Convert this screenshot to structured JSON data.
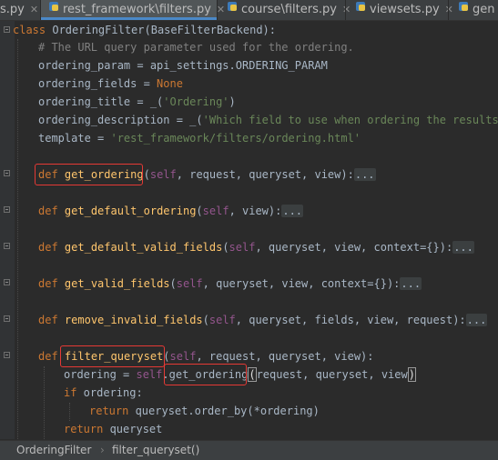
{
  "tabs": [
    {
      "label": "s.py",
      "active": false
    },
    {
      "label": "rest_framework\\filters.py",
      "active": true
    },
    {
      "label": "course\\filters.py",
      "active": false
    },
    {
      "label": "viewsets.py",
      "active": false
    },
    {
      "label": "gen",
      "active": false
    }
  ],
  "code": {
    "class_line": {
      "kw": "class",
      "rest": " OrderingFilter(BaseFilterBackend):"
    },
    "comment": "# The URL query parameter used for the ordering.",
    "ordering_param": {
      "lhs": "ordering_param = api_settings.ORDERING_PARAM"
    },
    "ordering_fields": {
      "lhs": "ordering_fields = ",
      "val": "None"
    },
    "ordering_title": {
      "lhs": "ordering_title = _(",
      "str": "'Ordering'",
      "end": ")"
    },
    "ordering_description": {
      "lhs": "ordering_description = _(",
      "str": "'Which field to use when ordering the results.'"
    },
    "template": {
      "lhs": "template = ",
      "str": "'rest_framework/filters/ordering.html'"
    },
    "def_kw": "def",
    "self_kw": "self",
    "ellipsis": "...",
    "methods": [
      {
        "name": "get_ordering",
        "args": ", request, queryset, view):"
      },
      {
        "name": "get_default_ordering",
        "args": ", view):"
      },
      {
        "name": "get_default_valid_fields",
        "args": ", queryset, view, context={}):"
      },
      {
        "name": "get_valid_fields",
        "args": ", queryset, view, context={}):"
      },
      {
        "name": "remove_invalid_fields",
        "args": ", queryset, fields, view, request):"
      }
    ],
    "filter_queryset": {
      "name": "filter_queryset",
      "args": ", request, queryset, view):"
    },
    "body": {
      "ordering_assign": "ordering = ",
      "call_dot": ".",
      "call_name": "get_ordering",
      "call_open": "(",
      "call_args": "request, queryset, view",
      "call_close": ")",
      "if_kw": "if",
      "if_rest": " ordering:",
      "return_kw": "return",
      "return1_rest": " queryset.order_by(*ordering)",
      "return2_rest": " queryset"
    }
  },
  "breadcrumb": [
    "OrderingFilter",
    "filter_queryset()"
  ],
  "colors": {
    "keyword": "#cc7832",
    "function": "#ffc66d",
    "string": "#6a8759",
    "comment": "#808080",
    "self": "#94558d",
    "highlight_box": "#e53935"
  }
}
